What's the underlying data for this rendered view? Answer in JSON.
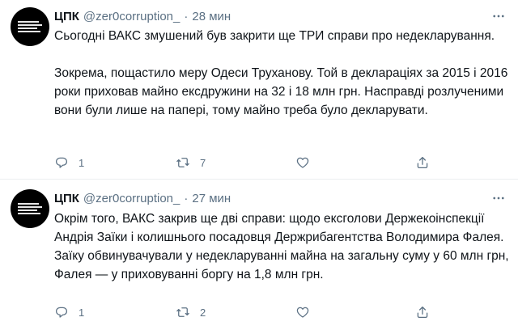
{
  "tweets": [
    {
      "author_name": "ЦПК",
      "handle": "@zer0corruption_",
      "separator": "·",
      "time": "28 мин",
      "paragraphs": [
        "Сьогодні ВАКС змушений був закрити ще ТРИ справи про недекларування.",
        "Зокрема, пощастило меру Одеси Труханову. Той в деклараціях за 2015 і 2016 роки приховав майно ексдружини на 32 і 18 млн грн. Насправді розлученими вони були лише на папері, тому майно треба було декларувати."
      ],
      "reply_count": "1",
      "retweet_count": "7",
      "like_count": "",
      "icons": {
        "reply": "comment-icon",
        "retweet": "retweet-icon",
        "like": "heart-icon",
        "share": "share-icon",
        "more": "more-options-icon"
      }
    },
    {
      "author_name": "ЦПК",
      "handle": "@zer0corruption_",
      "separator": "·",
      "time": "27 мин",
      "paragraphs": [
        "Окрім того, ВАКС закрив ще дві справи: щодо ексголови Держекоінспекції Андрія Заїки і колишнього посадовця Держрибагентства Володимира Фалея. Заїку обвинувачували у недекларуванні майна на загальну суму у 60 млн грн, Фалея — у приховуванні боргу на 1,8 млн грн."
      ],
      "reply_count": "1",
      "retweet_count": "2",
      "like_count": "",
      "icons": {
        "reply": "comment-icon",
        "retweet": "retweet-icon",
        "like": "heart-icon",
        "share": "share-icon",
        "more": "more-options-icon"
      }
    }
  ],
  "colors": {
    "text_primary": "#0f1419",
    "text_secondary": "#5b7083",
    "divider": "#ebeef0",
    "avatar_bg": "#000000"
  }
}
